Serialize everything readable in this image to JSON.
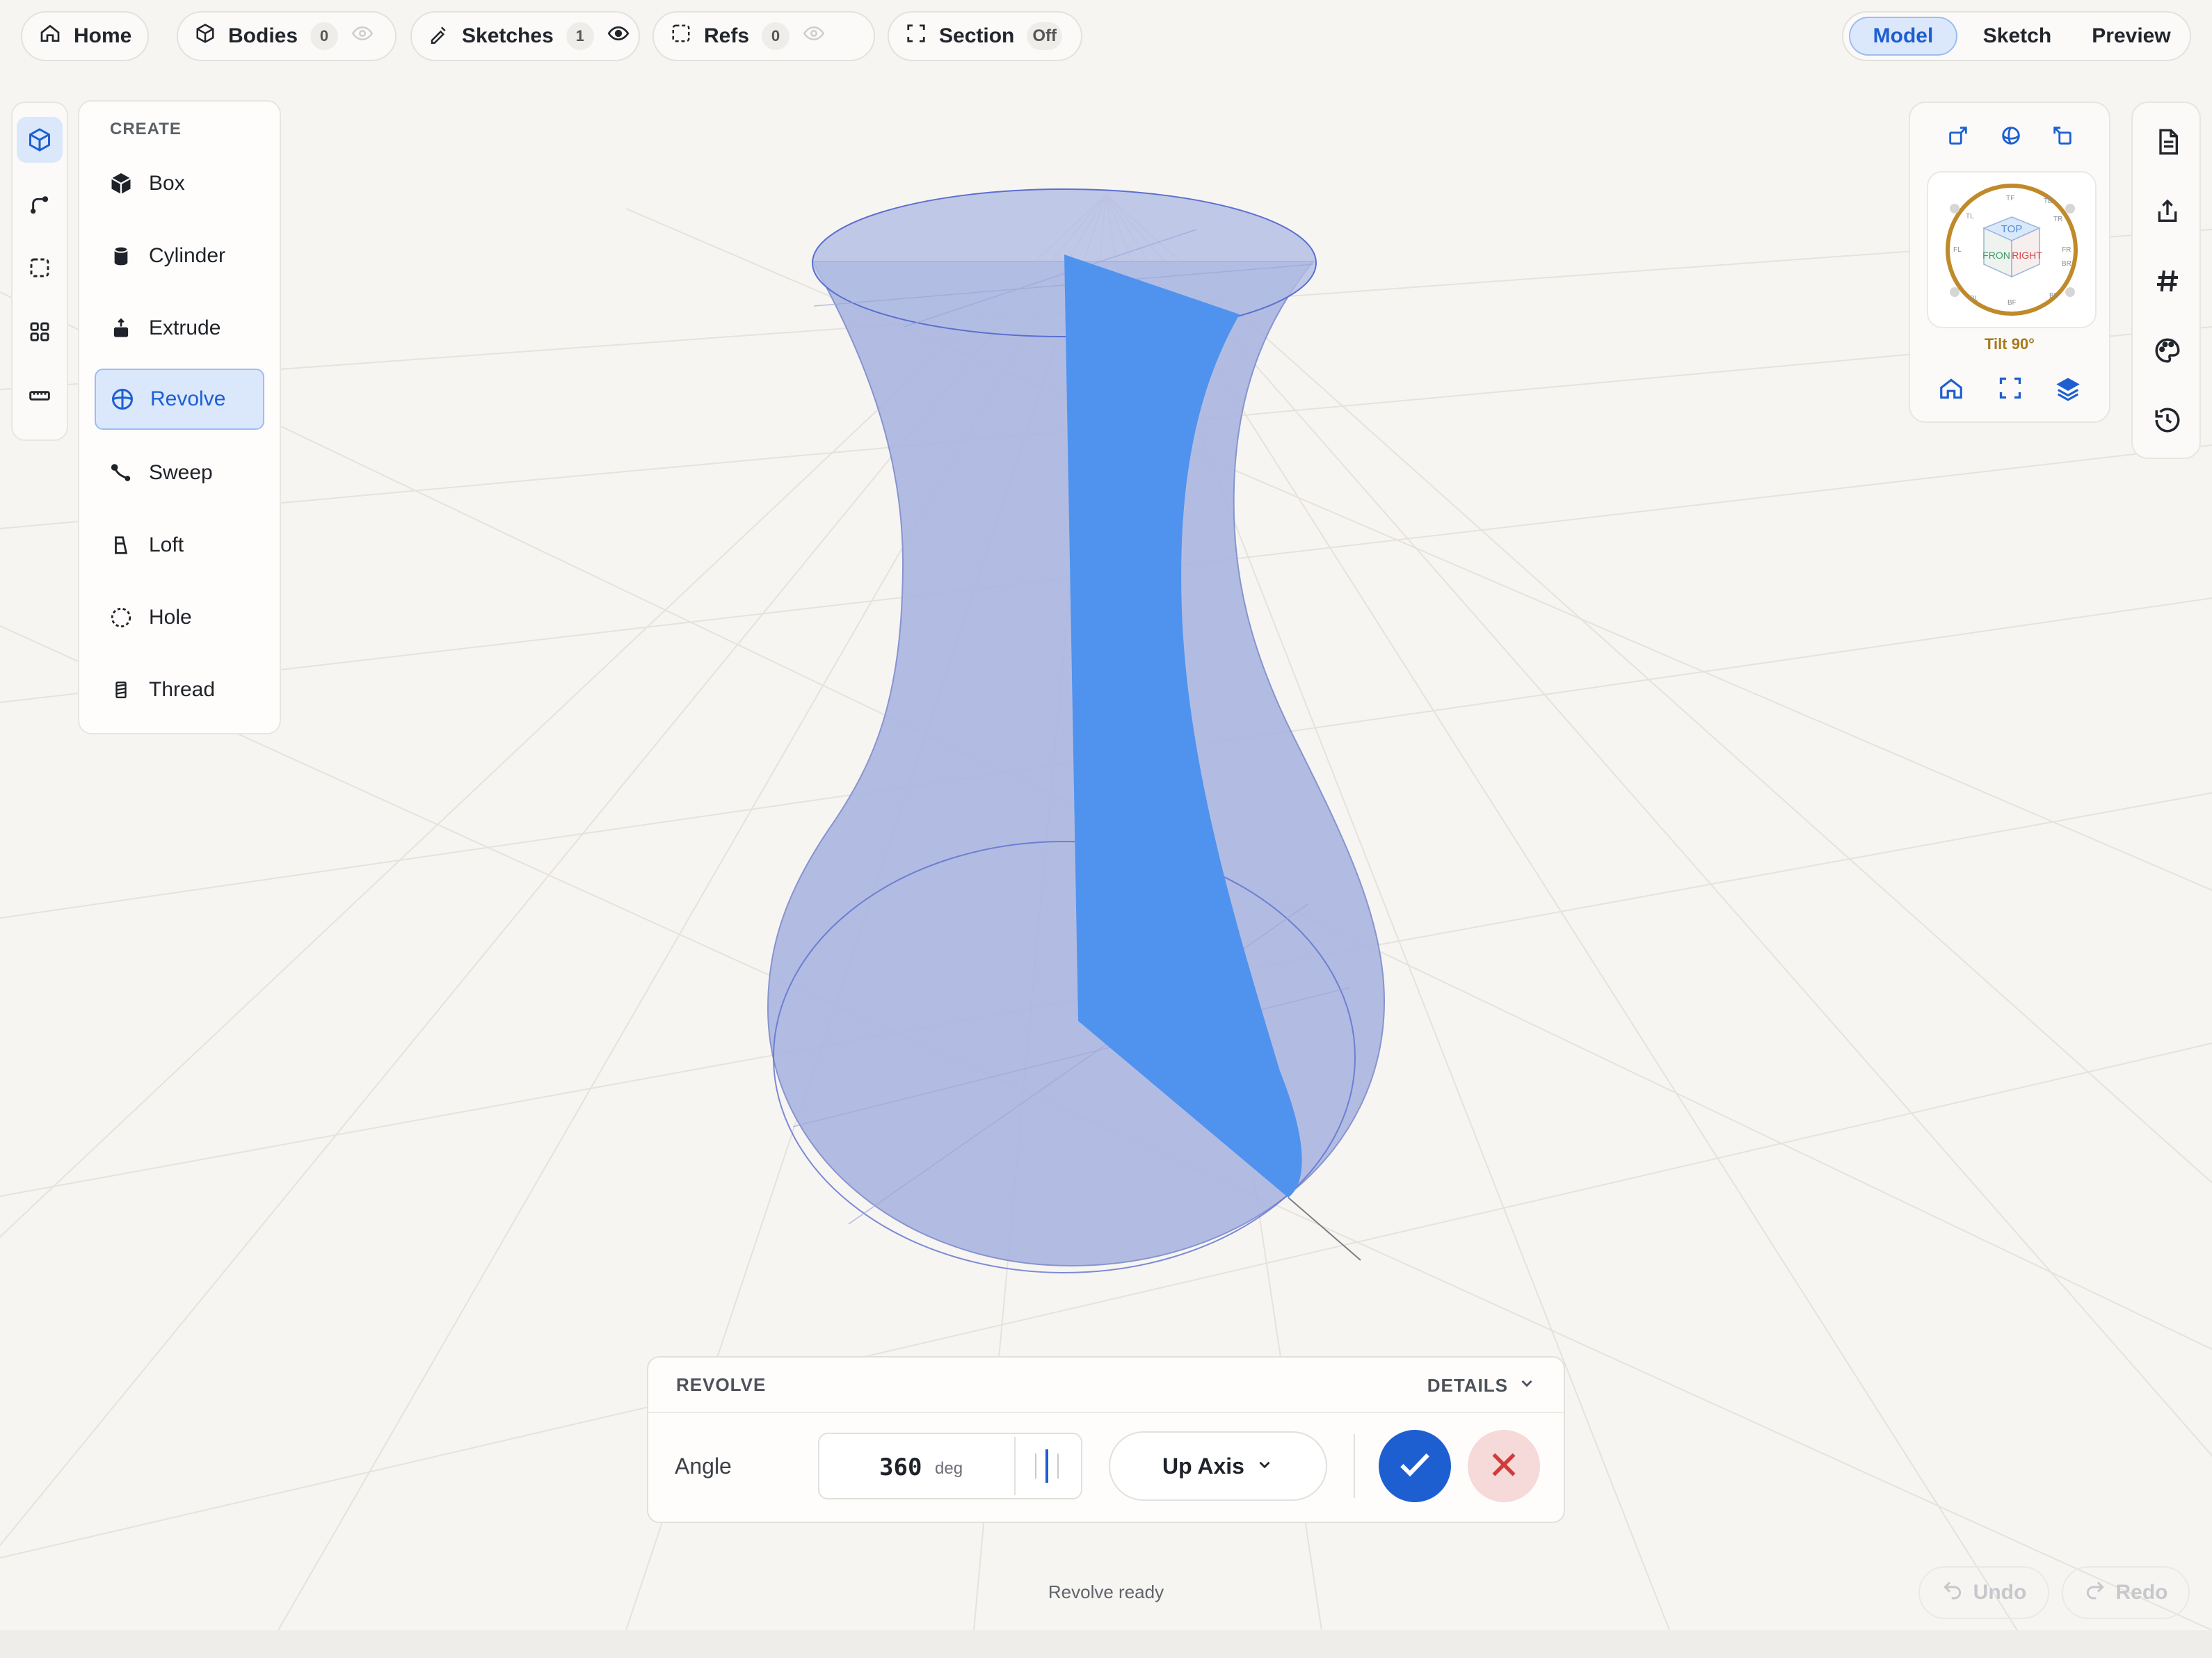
{
  "toolbar": {
    "home": {
      "label": "Home"
    },
    "bodies": {
      "label": "Bodies",
      "count": "0"
    },
    "sketches": {
      "label": "Sketches",
      "count": "1"
    },
    "refs": {
      "label": "Refs",
      "count": "0"
    },
    "section": {
      "label": "Section",
      "state": "Off"
    }
  },
  "modes": {
    "model": "Model",
    "sketch": "Sketch",
    "preview": "Preview",
    "active": "Model"
  },
  "left_rail": {
    "items": [
      "solid-cube-icon",
      "sketch-curve-icon",
      "selection-frame-icon",
      "grid-apps-icon",
      "ruler-icon"
    ],
    "active": "solid-cube-icon"
  },
  "create_menu": {
    "heading": "CREATE",
    "items": [
      {
        "label": "Box",
        "icon": "box-icon"
      },
      {
        "label": "Cylinder",
        "icon": "cylinder-icon"
      },
      {
        "label": "Extrude",
        "icon": "extrude-icon"
      },
      {
        "label": "Revolve",
        "icon": "revolve-icon"
      },
      {
        "label": "Sweep",
        "icon": "sweep-icon"
      },
      {
        "label": "Loft",
        "icon": "loft-icon"
      },
      {
        "label": "Hole",
        "icon": "hole-icon"
      },
      {
        "label": "Thread",
        "icon": "thread-icon"
      }
    ],
    "active": "Revolve"
  },
  "viewcube": {
    "faces": {
      "top": "TOP",
      "front": "FRON",
      "right": "RIGHT"
    },
    "ring_labels": [
      "TF",
      "TB",
      "TR",
      "FR",
      "BR",
      "BB",
      "BF",
      "BL",
      "FL",
      "TL"
    ],
    "tilt": "Tilt 90°",
    "ring_color": "#c08a2a"
  },
  "right_rail": {
    "items": [
      "document-icon",
      "share-icon",
      "hash-icon",
      "palette-icon",
      "history-icon"
    ]
  },
  "revolve_panel": {
    "title": "REVOLVE",
    "details": "DETAILS",
    "angle_label": "Angle",
    "angle_value": "360",
    "angle_unit": "deg",
    "axis": "Up Axis"
  },
  "status": "Revolve ready",
  "undo": "Undo",
  "redo": "Redo",
  "colors": {
    "accent": "#1d5fd1",
    "profile": "#4f93ee",
    "solid": "#aab6e0",
    "cancel_bg": "#f6d9d9",
    "cancel_x": "#d33a3a"
  }
}
